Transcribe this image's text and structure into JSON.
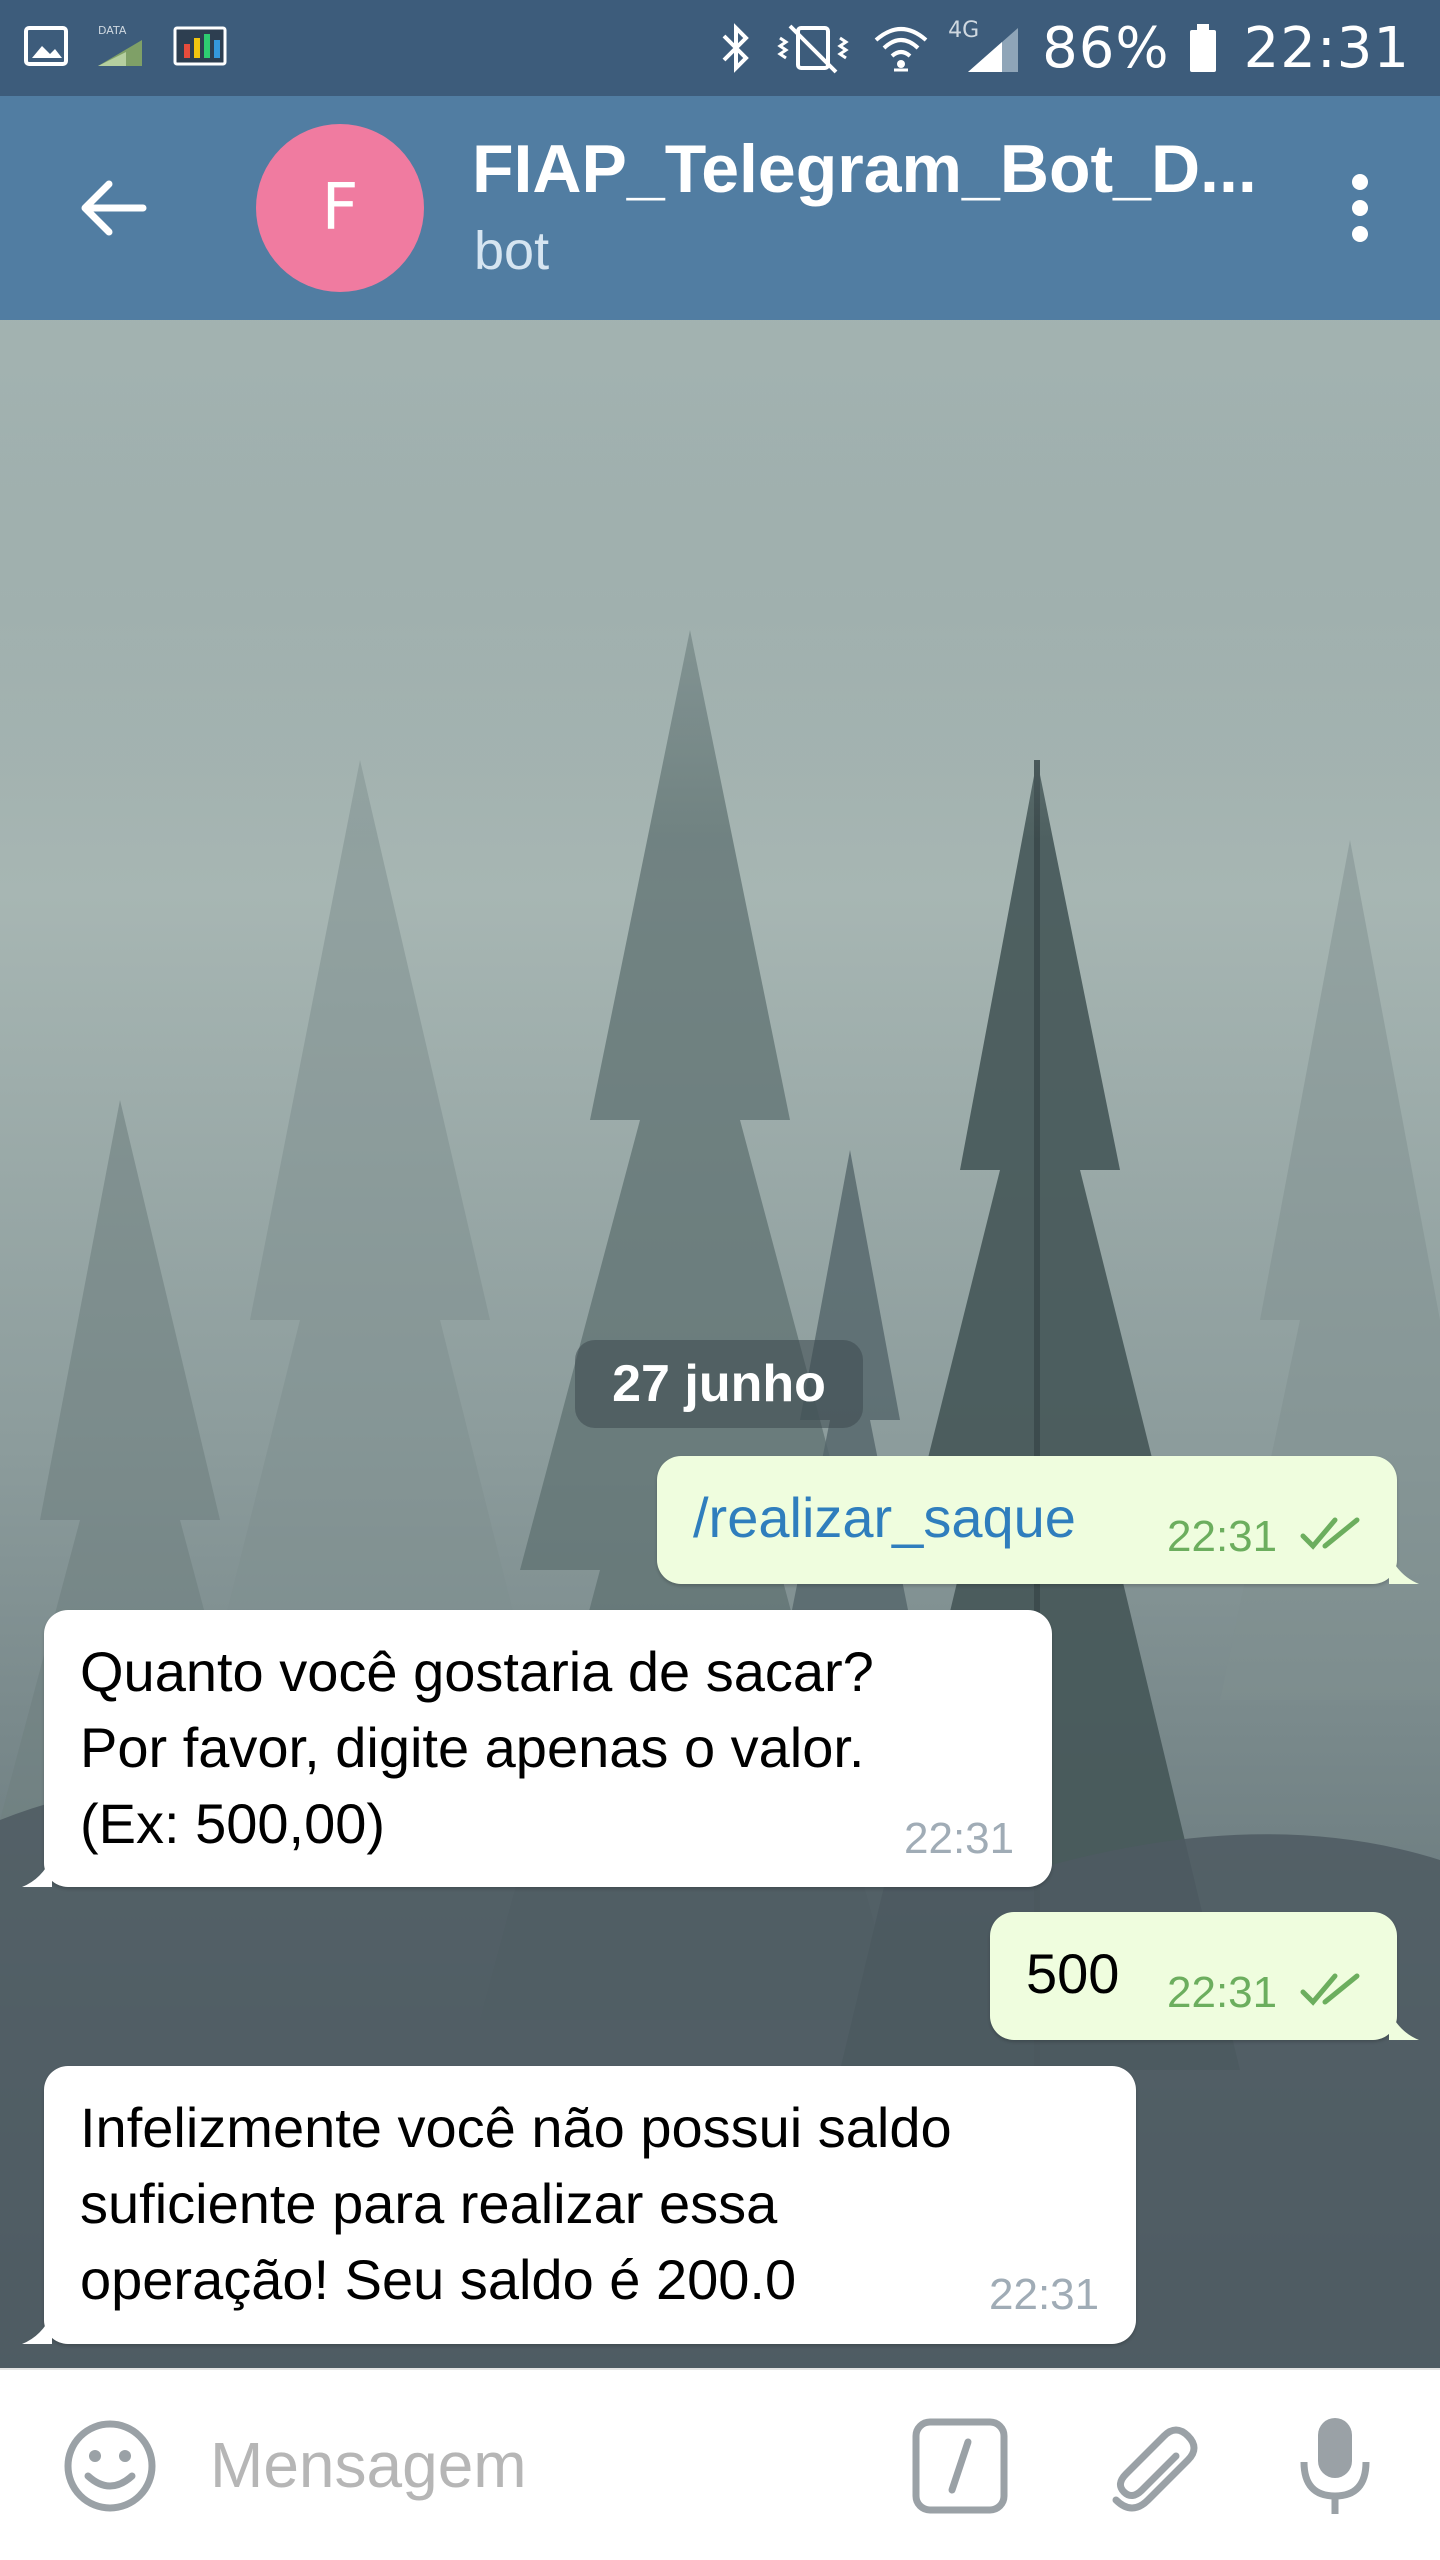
{
  "status_bar": {
    "battery_percent": "86%",
    "time": "22:31",
    "network_type": "4G",
    "data_label": "DATA",
    "icons": [
      "gallery-icon",
      "data-icon",
      "monitor-icon",
      "bluetooth-icon",
      "vibrate-icon",
      "wifi-icon",
      "signal-icon",
      "battery-icon"
    ]
  },
  "header": {
    "avatar_letter": "F",
    "avatar_color": "#f07ba0",
    "title": "FIAP_Telegram_Bot_D...",
    "subtitle": "bot",
    "bar_color": "#517da2"
  },
  "chat": {
    "date_label": "27 junho",
    "messages": [
      {
        "direction": "out",
        "text": "/realizar_saque",
        "time": "22:31",
        "read": true
      },
      {
        "direction": "in",
        "text": "Quanto você gostaria de sacar?\nPor favor, digite apenas o valor.\n(Ex: 500,00)",
        "time": "22:31"
      },
      {
        "direction": "out",
        "text": "500",
        "time": "22:31",
        "read": true
      },
      {
        "direction": "in",
        "text": "Infelizmente você não possui saldo\nsuficiente para realizar essa\noperação! Seu saldo é 200.0",
        "time": "22:31"
      }
    ]
  },
  "input_bar": {
    "placeholder": "Mensagem"
  }
}
